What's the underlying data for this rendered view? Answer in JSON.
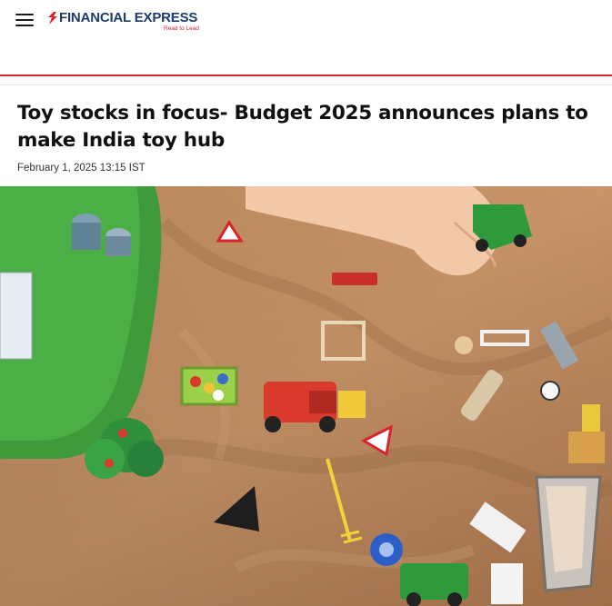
{
  "brand": {
    "name": "FINANCIAL EXPRESS",
    "tagline": "Read to Lead",
    "primary_color": "#1e3a6e",
    "accent_color": "#d9232d"
  },
  "header": {
    "menu_icon": "hamburger-menu-icon"
  },
  "article": {
    "headline": "Toy stocks in focus- Budget 2025 announces plans to make India toy hub",
    "published": "February 1, 2025 13:15 IST",
    "hero_image_subject": "toys-on-brown-cloth-photo"
  }
}
